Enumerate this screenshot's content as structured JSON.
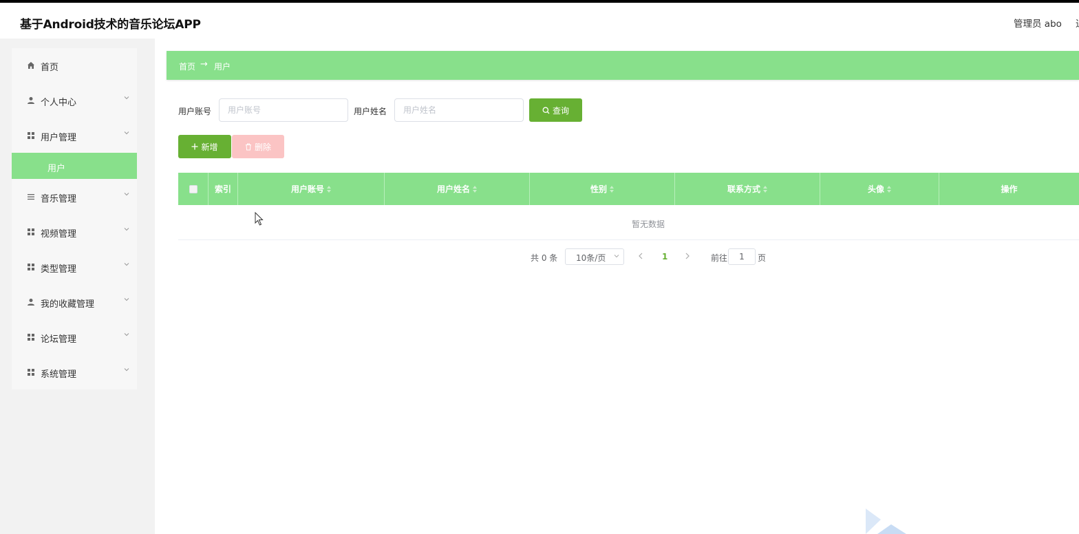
{
  "header": {
    "title": "基于Android技术的音乐论坛APP",
    "user": "管理员 abo",
    "logout": "退"
  },
  "sidebar": {
    "items": [
      {
        "label": "首页",
        "icon": "home-icon"
      },
      {
        "label": "个人中心",
        "icon": "user-icon"
      },
      {
        "label": "用户管理",
        "icon": "grid-icon"
      },
      {
        "label": "音乐管理",
        "icon": "list-icon"
      },
      {
        "label": "视频管理",
        "icon": "grid-icon"
      },
      {
        "label": "类型管理",
        "icon": "grid-icon"
      },
      {
        "label": "我的收藏管理",
        "icon": "user-icon"
      },
      {
        "label": "论坛管理",
        "icon": "grid-icon"
      },
      {
        "label": "系统管理",
        "icon": "grid-icon"
      }
    ],
    "active_sub": "用户"
  },
  "breadcrumb": {
    "home": "首页",
    "separator": "→",
    "current": "用户"
  },
  "search": {
    "account_label": "用户账号",
    "account_placeholder": "用户账号",
    "name_label": "用户姓名",
    "name_placeholder": "用户姓名",
    "query_button": "查询"
  },
  "actions": {
    "add": "新增",
    "delete": "删除"
  },
  "table": {
    "columns": [
      "索引",
      "用户账号",
      "用户姓名",
      "性别",
      "联系方式",
      "头像",
      "操作"
    ],
    "empty_text": "暂无数据"
  },
  "pagination": {
    "total": "共 0 条",
    "page_size": "10条/页",
    "current_page": "1",
    "goto_label": "前往",
    "goto_value": "1",
    "goto_unit": "页"
  },
  "colors": {
    "accent": "#88e08b",
    "primary_button": "#67b033",
    "danger_disabled": "#fbc4c4"
  }
}
